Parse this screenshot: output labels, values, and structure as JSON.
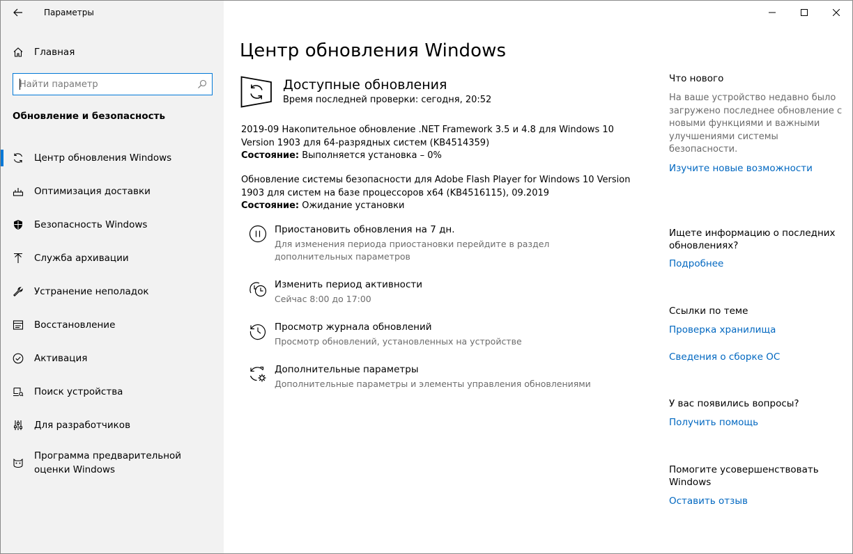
{
  "window": {
    "app_title": "Параметры",
    "controls": {
      "minimize": "minimize",
      "maximize": "maximize",
      "close": "close"
    }
  },
  "sidebar": {
    "home_label": "Главная",
    "search_placeholder": "Найти параметр",
    "section_title": "Обновление и безопасность",
    "items": [
      {
        "label": "Центр обновления Windows",
        "icon": "refresh-icon",
        "active": true
      },
      {
        "label": "Оптимизация доставки",
        "icon": "delivery-optimization-icon"
      },
      {
        "label": "Безопасность Windows",
        "icon": "shield-icon"
      },
      {
        "label": "Служба архивации",
        "icon": "backup-arrow-icon"
      },
      {
        "label": "Устранение неполадок",
        "icon": "wrench-icon"
      },
      {
        "label": "Восстановление",
        "icon": "recovery-icon"
      },
      {
        "label": "Активация",
        "icon": "check-circle-icon"
      },
      {
        "label": "Поиск устройства",
        "icon": "find-device-icon"
      },
      {
        "label": "Для разработчиков",
        "icon": "developer-sliders-icon"
      },
      {
        "label": "Программа предварительной оценки Windows",
        "icon": "insider-cat-icon"
      }
    ]
  },
  "main": {
    "page_title": "Центр обновления Windows",
    "status": {
      "title": "Доступные обновления",
      "last_check": "Время последней проверки: сегодня, 20:52"
    },
    "updates": [
      {
        "name": "2019-09 Накопительное обновление .NET Framework 3.5 и 4.8 для Windows 10 Version 1903 для 64-разрядных систем (KB4514359)",
        "status_label": "Состояние:",
        "status_value": " Выполняется установка – 0%"
      },
      {
        "name": "Обновление системы безопасности для Adobe Flash Player for Windows 10 Version 1903 для систем на базе процессоров x64 (KB4516115), 09.2019",
        "status_label": "Состояние:",
        "status_value": " Ожидание установки"
      }
    ],
    "options": [
      {
        "title": "Приостановить обновления на 7 дн.",
        "desc": "Для изменения периода приостановки перейдите в раздел дополнительных параметров",
        "icon": "pause-icon"
      },
      {
        "title": "Изменить период активности",
        "desc": "Сейчас 8:00 до 17:00",
        "icon": "active-hours-icon"
      },
      {
        "title": "Просмотр журнала обновлений",
        "desc": "Просмотр обновлений, установленных на устройстве",
        "icon": "history-icon"
      },
      {
        "title": "Дополнительные параметры",
        "desc": "Дополнительные параметры и элементы управления обновлениями",
        "icon": "advanced-settings-icon"
      }
    ]
  },
  "right": {
    "whats_new": {
      "heading": "Что нового",
      "text": "На ваше устройство недавно было загружено последнее обновление с новыми функциями и важными улучшениями системы безопасности.",
      "link": "Изучите новые возможности"
    },
    "info": {
      "heading": "Ищете информацию о последних обновлениях?",
      "link": "Подробнее"
    },
    "related": {
      "heading": "Ссылки по теме",
      "links": [
        "Проверка хранилища",
        "Сведения о сборке ОС"
      ]
    },
    "questions": {
      "heading": "У вас появились вопросы?",
      "link": "Получить помощь"
    },
    "feedback": {
      "heading": "Помогите усовершенствовать Windows",
      "link": "Оставить отзыв"
    }
  },
  "colors": {
    "accent": "#0078d7",
    "link": "#0067c0",
    "sidebar_bg": "#f2f2f2",
    "secondary_text": "#6b6b6b"
  }
}
